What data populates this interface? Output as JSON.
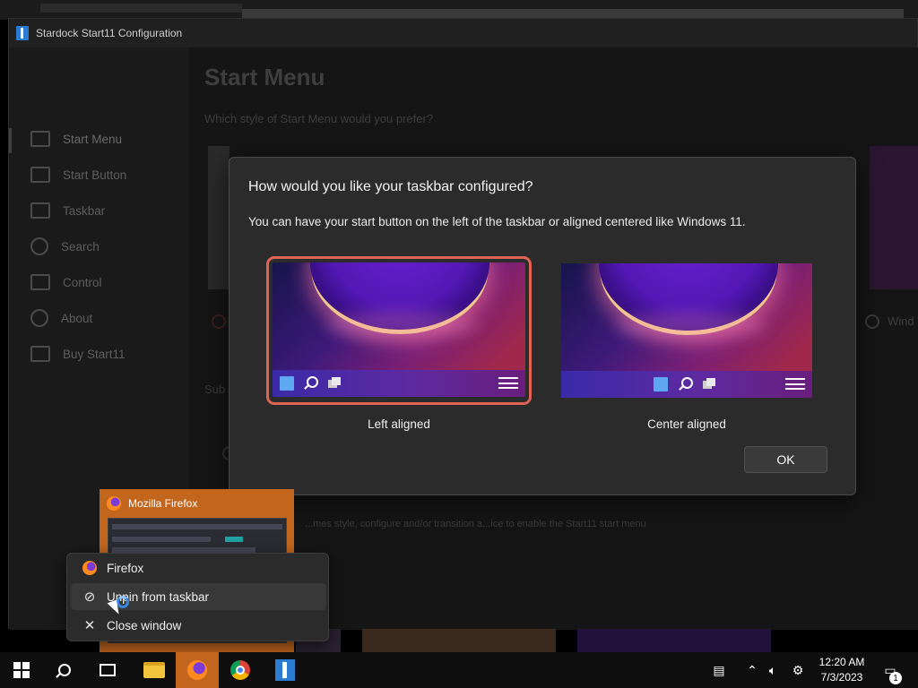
{
  "window": {
    "title": "Stardock Start11 Configuration"
  },
  "sidebar": {
    "items": [
      {
        "label": "Start Menu",
        "icon": "start-menu-icon"
      },
      {
        "label": "Start Button",
        "icon": "start-button-icon"
      },
      {
        "label": "Taskbar",
        "icon": "taskbar-icon"
      },
      {
        "label": "Search",
        "icon": "search-icon"
      },
      {
        "label": "Control",
        "icon": "control-icon"
      },
      {
        "label": "About",
        "icon": "info-icon"
      },
      {
        "label": "Buy Start11",
        "icon": "cart-icon"
      }
    ]
  },
  "main": {
    "title": "Start Menu",
    "question": "Which style of Start Menu would you prefer?",
    "right_radio_label": "Wind",
    "sub_label": "Sub",
    "hint": "...mes style, configure and/or transition a...ice to enable the Start11 start menu"
  },
  "dialog": {
    "title": "How would you like your taskbar configured?",
    "description": "You can have your start button on the left of the taskbar or aligned centered like Windows 11.",
    "options": [
      {
        "label": "Left aligned",
        "selected": true
      },
      {
        "label": "Center aligned",
        "selected": false
      }
    ],
    "ok_label": "OK"
  },
  "thumbnail": {
    "title": "Mozilla Firefox"
  },
  "context_menu": {
    "items": [
      {
        "label": "Firefox",
        "icon": "firefox-icon"
      },
      {
        "label": "Unpin from taskbar",
        "icon": "unpin-icon"
      },
      {
        "label": "Close window",
        "icon": "close-icon"
      }
    ]
  },
  "taskbar": {
    "apps": [
      "start",
      "search",
      "task-view",
      "file-explorer",
      "firefox",
      "chrome",
      "start11"
    ],
    "clock_time": "12:20 AM",
    "clock_date": "7/3/2023",
    "notification_count": "1"
  },
  "colors": {
    "accent_selected": "#e06456",
    "taskbar_active": "#c3661d"
  }
}
